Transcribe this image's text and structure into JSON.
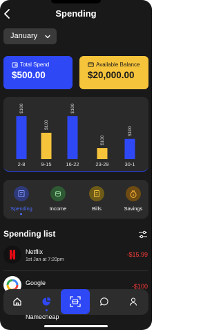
{
  "header": {
    "title": "Spending"
  },
  "filter": {
    "month": "January"
  },
  "cards": {
    "total_spend": {
      "label": "Total Spend",
      "value": "$500.00",
      "color": "#2f48f5",
      "icon": "wallet-icon"
    },
    "available_balance": {
      "label": "Available Balance",
      "value": "$20,000.00",
      "color": "#f6c43b",
      "icon": "card-icon"
    }
  },
  "chart_data": {
    "type": "bar",
    "categories": [
      "2-8",
      "9-15",
      "16-22",
      "23-29",
      "30-1"
    ],
    "values": [
      70,
      43,
      70,
      18,
      33
    ],
    "data_labels": [
      "$100",
      "$100",
      "$100",
      "$100",
      "$100"
    ],
    "colors": [
      "#2f48f5",
      "#f6c43b",
      "#2f48f5",
      "#f6c43b",
      "#2f48f5"
    ]
  },
  "categories": [
    {
      "label": "Spending",
      "icon": "receipt-icon",
      "color": "#2f3a7a",
      "active": true
    },
    {
      "label": "Income",
      "icon": "coins-icon",
      "color": "#2e5a33",
      "active": false
    },
    {
      "label": "Bills",
      "icon": "bill-icon",
      "color": "#6e5b18",
      "active": false
    },
    {
      "label": "Savings",
      "icon": "money-bag-icon",
      "color": "#6e4b12",
      "active": false
    }
  ],
  "spending_list": {
    "title": "Spending list",
    "items": [
      {
        "name": "Netflix",
        "date": "1st Jan at 7:20pm",
        "amount": "-$15.99",
        "logo": "netflix-logo"
      },
      {
        "name": "Google",
        "date": "",
        "amount": "-$100",
        "logo": "google-logo"
      },
      {
        "name": "Namecheap",
        "date": "",
        "amount": "",
        "logo": "namecheap-logo"
      }
    ]
  },
  "nav": {
    "items": [
      "home-icon",
      "chart-pie-icon",
      "scan-icon",
      "chat-icon",
      "user-icon"
    ],
    "active": "chart-pie-icon",
    "accent": "#2f48f5"
  }
}
